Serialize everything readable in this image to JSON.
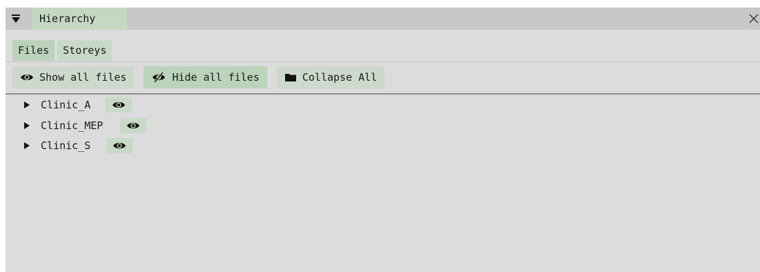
{
  "window": {
    "title": "Hierarchy"
  },
  "tabs": [
    {
      "label": "Files",
      "active": true
    },
    {
      "label": "Storeys",
      "active": false
    }
  ],
  "toolbar": {
    "show_all_label": "Show all files",
    "hide_all_label": "Hide all files",
    "collapse_all_label": "Collapse All",
    "show_all_icon": "eye-icon",
    "hide_all_icon": "eye-slash-icon",
    "collapse_all_icon": "folder-icon"
  },
  "tree": {
    "items": [
      {
        "label": "Clinic_A",
        "expanded": false,
        "visible": true
      },
      {
        "label": "Clinic_MEP",
        "expanded": false,
        "visible": true
      },
      {
        "label": "Clinic_S",
        "expanded": false,
        "visible": true
      }
    ]
  },
  "colors": {
    "panel_bg": "#dcdcdc",
    "titlebar_bg": "#c8c8c8",
    "accent_green": "#c4d8c3"
  }
}
